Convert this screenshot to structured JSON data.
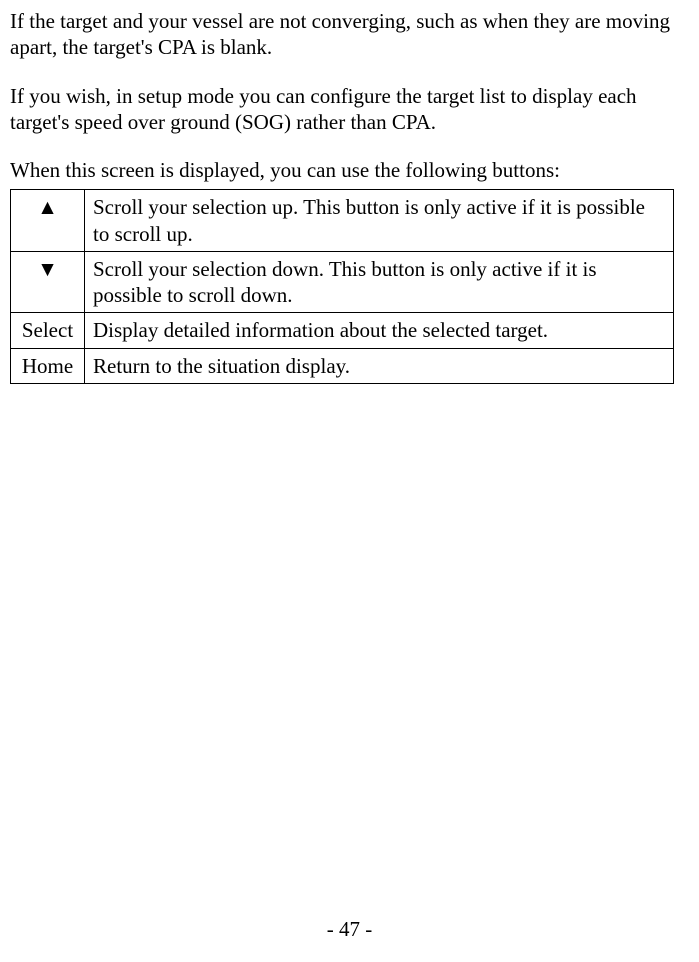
{
  "paragraphs": {
    "p1": "If the target and your vessel are not converging, such as when they are moving apart, the target's CPA is blank.",
    "p2": "If you wish, in setup mode you can configure the target list to display each target's speed over ground (SOG) rather than CPA.",
    "p3": "When this screen is displayed, you can use the following buttons:"
  },
  "button_table": [
    {
      "key": "▲",
      "desc": "Scroll your selection up. This button is only active if it is possible to scroll up."
    },
    {
      "key": "▼",
      "desc": "Scroll your selection down. This button is only active if it is possible to scroll down."
    },
    {
      "key": "Select",
      "desc": "Display detailed information about the selected target."
    },
    {
      "key": "Home",
      "desc": "Return to the situation display."
    }
  ],
  "page_number": "- 47 -"
}
